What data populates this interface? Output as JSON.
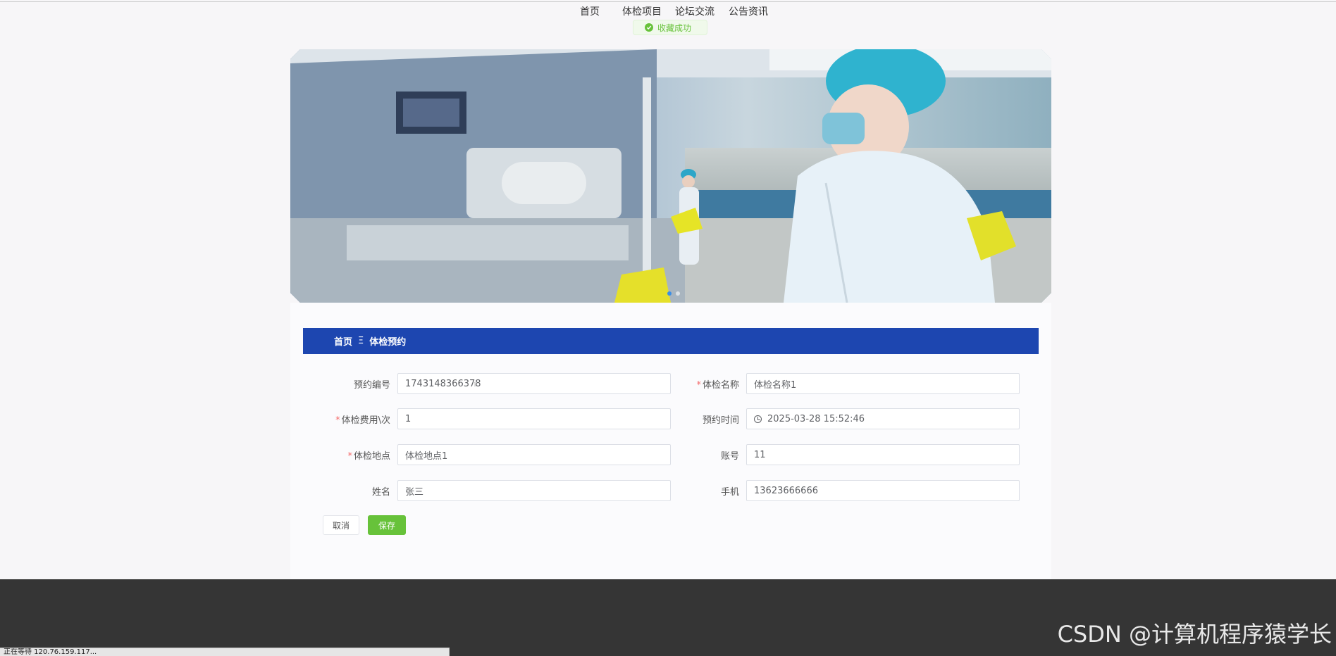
{
  "nav": {
    "items": [
      "首页",
      "体检项目",
      "论坛交流",
      "公告资讯"
    ]
  },
  "toast": {
    "text": "收藏成功",
    "icon": "check-circle-icon",
    "color": "#67c23a"
  },
  "banner": {
    "description": "laboratory-photo",
    "active_slide": 1,
    "slide_count": 2
  },
  "breadcrumb": {
    "home": "首页",
    "separator": "Ξ",
    "current": "体检预约",
    "background": "#1d46b0"
  },
  "form": {
    "order_no_label": "预约编号",
    "order_no_value": "1743148366378",
    "exam_name_label": "体检名称",
    "exam_name_value": "体检名称1",
    "fee_label": "体检费用\\次",
    "fee_value": "1",
    "time_label": "预约时间",
    "time_value": "2025-03-28 15:52:46",
    "place_label": "体检地点",
    "place_value": "体检地点1",
    "account_label": "账号",
    "account_value": "11",
    "name_label": "姓名",
    "name_value": "张三",
    "phone_label": "手机",
    "phone_value": "13623666666",
    "required_mark": "*"
  },
  "buttons": {
    "cancel": "取消",
    "save": "保存"
  },
  "watermark": "CSDN @计算机程序猿学长",
  "status_bar": "正在等待 120.76.159.117..."
}
